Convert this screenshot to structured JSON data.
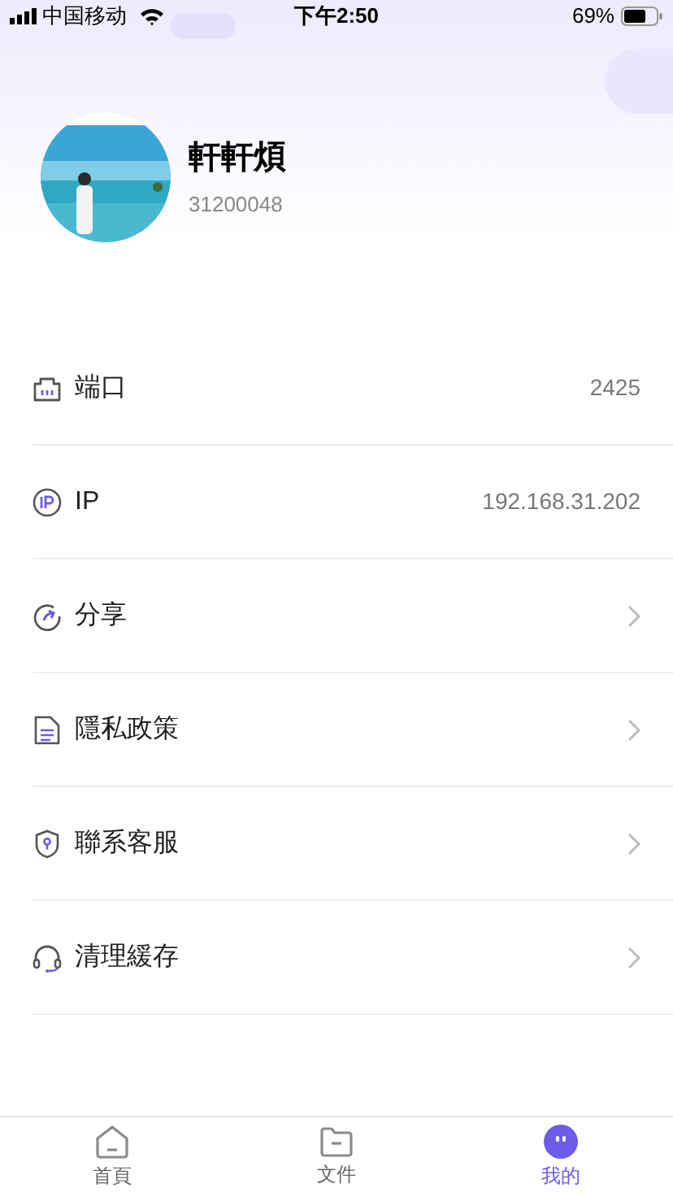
{
  "status_bar": {
    "carrier": "中国移动",
    "time": "下午2:50",
    "battery": "69%"
  },
  "profile": {
    "name": "軒軒煩",
    "id": "31200048"
  },
  "menu": [
    {
      "kind": "value",
      "label": "端口",
      "value": "2425"
    },
    {
      "kind": "value",
      "label": "IP",
      "value": "192.168.31.202"
    },
    {
      "kind": "link",
      "label": "分享"
    },
    {
      "kind": "link",
      "label": "隱私政策"
    },
    {
      "kind": "link",
      "label": "聯系客服"
    },
    {
      "kind": "link",
      "label": "清理緩存"
    }
  ],
  "tab_bar": [
    {
      "label": "首頁",
      "selected": false
    },
    {
      "label": "文件",
      "selected": false
    },
    {
      "label": "我的",
      "selected": true
    }
  ]
}
